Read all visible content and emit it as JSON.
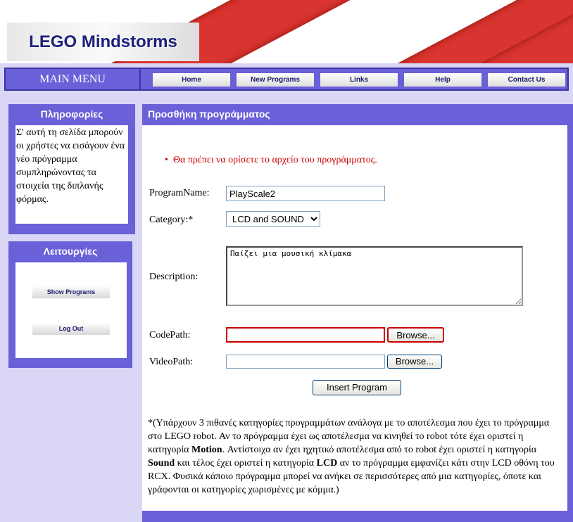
{
  "header": {
    "logo_text": "LEGO Mindstorms"
  },
  "menu": {
    "title": "MAIN MENU",
    "items": [
      "Home",
      "New Programs",
      "Links",
      "Help",
      "Contact Us"
    ]
  },
  "info": {
    "title": "Πληροφορίες",
    "text": "Σ' αυτή τη σελίδα μπορούν οι χρήστες να εισάγουν ένα νέο πρόγραμμα συμπληρώνοντας τα στοιχεία της διπλανής φόρμας."
  },
  "functions": {
    "title": "Λειτουργίες",
    "show_programs": "Show Programs",
    "log_out": "Log Out"
  },
  "form": {
    "title": "Προσθήκη προγράμματος",
    "error": "Θα πρέπει να ορίσετε το αρχείο του προγράμματος.",
    "program_name_label": "ProgramName:",
    "program_name_value": "PlayScale2",
    "category_label": "Category:*",
    "category_value": "LCD and SOUND",
    "description_label": "Description:",
    "description_value": "Παίζει μια μουσική κλίμακα",
    "codepath_label": "CodePath:",
    "videopath_label": "VideoPath:",
    "browse": "Browse...",
    "submit": "Insert Program",
    "error_color": "#cc0000"
  },
  "note": {
    "p1": "*(Υπάρχουν 3 πιθανές κατηγορίες προγραμμάτων ανάλογα με το αποτέλεσμα που έχει το πρόγραμμα στο LEGO robot. Αν το πρόγραμμα έχει ως αποτέλεσμα να κινηθεί το robot τότε έχει οριστεί η κατηγορία ",
    "motion": "Motion",
    "p2": ". Αντίστοιχα αν έχει ηχητικό αποτέλεσμα από το robot έχει οριστεί η κατηγορία ",
    "sound": "Sound",
    "p3": " και τέλος έχει οριστεί η κατηγορία ",
    "lcd": "LCD",
    "p4": " αν το πρόγραμμα εμφανίζει κάτι στην LCD οθόνη του RCX. Φυσικά κάποιο πρόγραμμα μπορεί να ανήκει σε περισσότερες από μια κατηγορίες, όποτε και γράφονται οι κατηγορίες χωρισμένες με κόμμα.)"
  }
}
